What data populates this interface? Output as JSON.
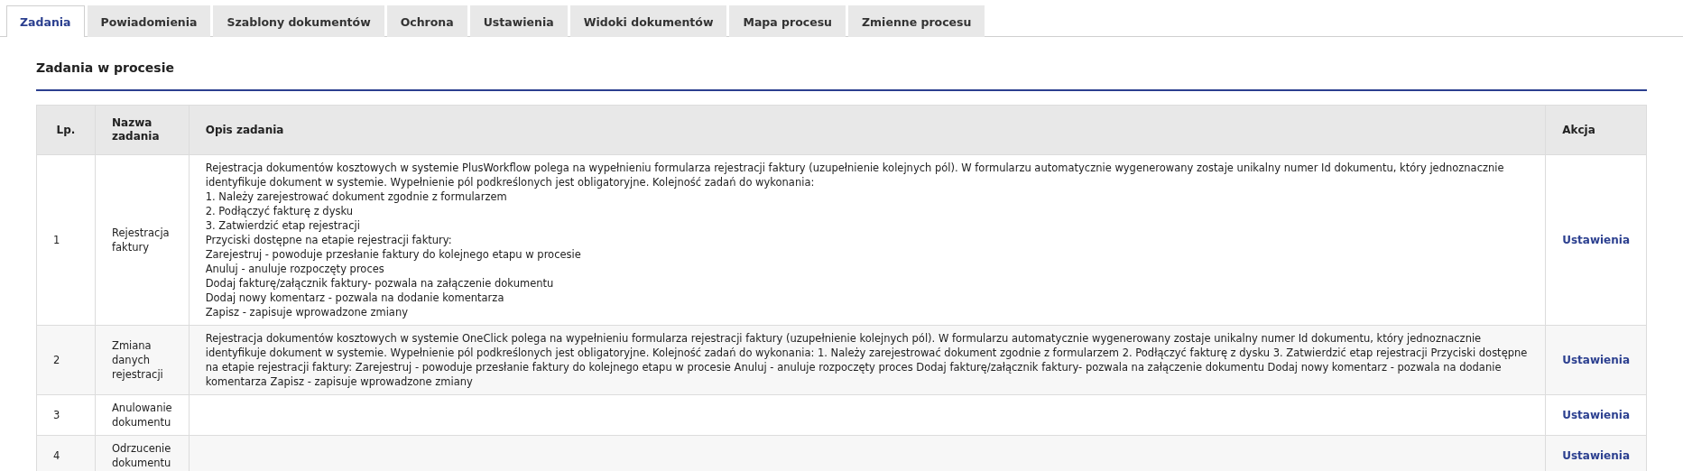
{
  "tabs": [
    {
      "label": "Zadania",
      "selected": true
    },
    {
      "label": "Powiadomienia",
      "selected": false
    },
    {
      "label": "Szablony dokumentów",
      "selected": false
    },
    {
      "label": "Ochrona",
      "selected": false
    },
    {
      "label": "Ustawienia",
      "selected": false
    },
    {
      "label": "Widoki dokumentów",
      "selected": false
    },
    {
      "label": "Mapa procesu",
      "selected": false
    },
    {
      "label": "Zmienne procesu",
      "selected": false
    }
  ],
  "section_title": "Zadania w procesie",
  "table": {
    "columns": [
      "Lp.",
      "Nazwa zadania",
      "Opis zadania",
      "Akcja"
    ],
    "rows": [
      {
        "number": "1",
        "name": "Rejestracja faktury",
        "description": [
          "Rejestracja dokumentów kosztowych w systemie PlusWorkflow polega na wypełnieniu formularza rejestracji faktury (uzupełnienie kolejnych pól). W formularzu automatycznie wygenerowany zostaje unikalny numer Id dokumentu, który jednoznacznie identyfikuje dokument w systemie. Wypełnienie pól podkreślonych jest obligatoryjne. Kolejność zadań do wykonania:",
          "1. Należy zarejestrować dokument zgodnie z formularzem",
          "2. Podłączyć fakturę z dysku",
          "3. Zatwierdzić etap rejestracji",
          "Przyciski dostępne na etapie rejestracji faktury:",
          "Zarejestruj - powoduje przesłanie faktury do kolejnego etapu w procesie",
          "Anuluj - anuluje rozpoczęty proces",
          "Dodaj fakturę/załącznik faktury- pozwala na załączenie dokumentu",
          "Dodaj nowy komentarz - pozwala na dodanie komentarza",
          "Zapisz - zapisuje wprowadzone zmiany"
        ],
        "action": "Ustawienia"
      },
      {
        "number": "2",
        "name": "Zmiana danych rejestracji",
        "description": [
          "Rejestracja dokumentów kosztowych w systemie OneClick polega na wypełnieniu formularza rejestracji faktury (uzupełnienie kolejnych pól). W formularzu automatycznie wygenerowany zostaje unikalny numer Id dokumentu, który jednoznacznie identyfikuje dokument w systemie. Wypełnienie pól podkreślonych jest obligatoryjne. Kolejność zadań do wykonania: 1. Należy zarejestrować dokument zgodnie z formularzem 2. Podłączyć fakturę z dysku 3. Zatwierdzić etap rejestracji Przyciski dostępne na etapie rejestracji faktury: Zarejestruj - powoduje przesłanie faktury do kolejnego etapu w procesie Anuluj - anuluje rozpoczęty proces Dodaj fakturę/załącznik faktury- pozwala na załączenie dokumentu Dodaj nowy komentarz - pozwala na dodanie komentarza Zapisz - zapisuje wprowadzone zmiany"
        ],
        "action": "Ustawienia"
      },
      {
        "number": "3",
        "name": "Anulowanie dokumentu",
        "description": [],
        "action": "Ustawienia"
      },
      {
        "number": "4",
        "name": "Odrzucenie dokumentu",
        "description": [],
        "action": "Ustawienia"
      }
    ]
  }
}
